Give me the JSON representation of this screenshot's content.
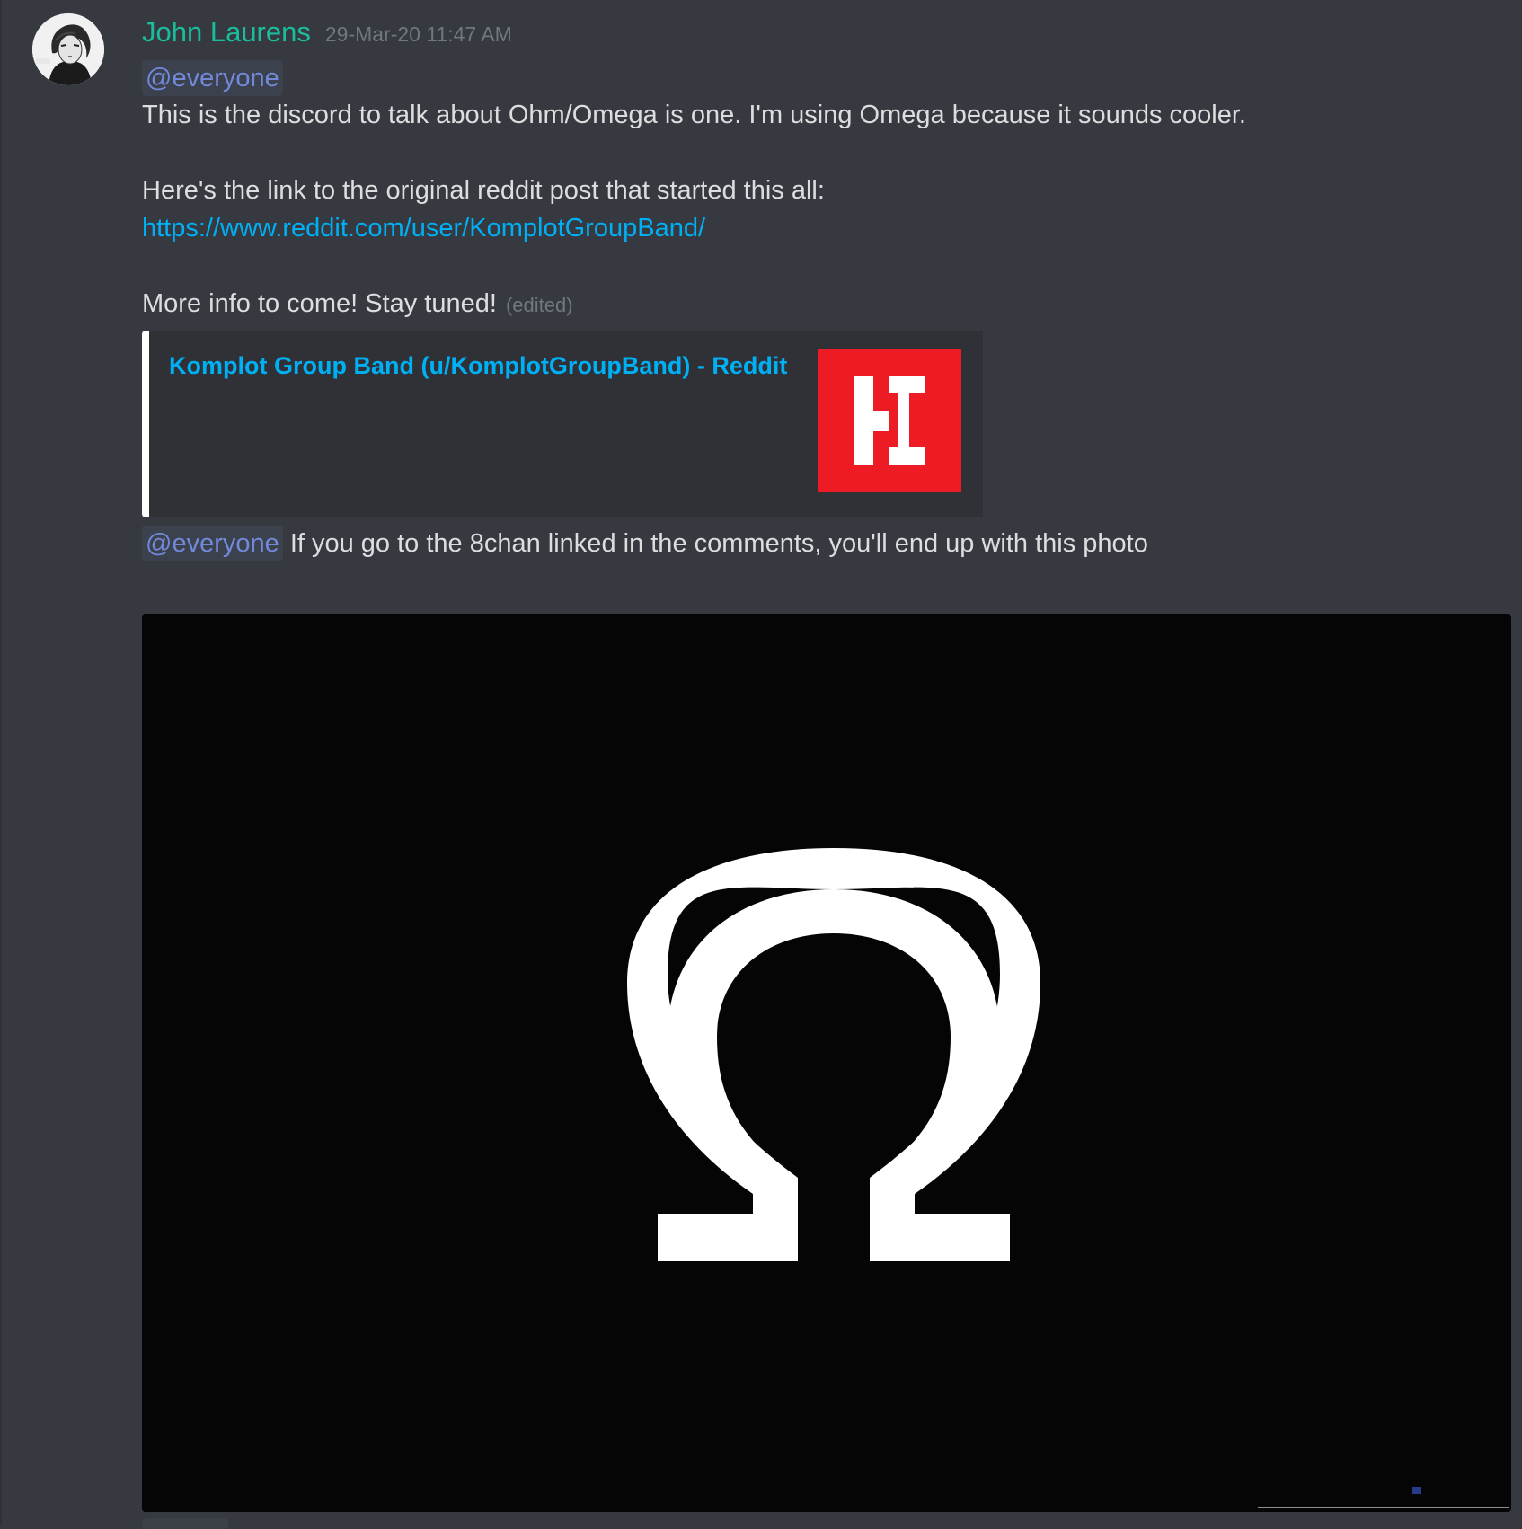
{
  "message": {
    "author": "John Laurens",
    "timestamp": "29-Mar-20 11:47 AM",
    "mention": "@everyone",
    "line1": "This is the discord to talk about Ohm/Omega is one. I'm using Omega because it sounds cooler.",
    "line2": "Here's the link to the original reddit post that started this all:",
    "link": "https://www.reddit.com/user/KomplotGroupBand/",
    "line3": "More info to come! Stay tuned!",
    "edited": "(edited)"
  },
  "embed": {
    "title": "Komplot Group Band (u/KomplotGroupBand) - Reddit",
    "accent_color": "#ffffff",
    "thumbnail_icon": "komplot-logo",
    "thumbnail_bg": "#ed1c24"
  },
  "second_message": {
    "mention": "@everyone",
    "text": "If you go to the 8chan linked in the comments, you'll end up with this photo"
  },
  "attachment": {
    "symbol": "Ω",
    "background": "#050505",
    "icon": "omega-symbol"
  },
  "colors": {
    "background": "#36393f",
    "username": "#1abc9c",
    "mention": "#7289da",
    "link": "#00b0f4",
    "muted": "#72767d"
  }
}
